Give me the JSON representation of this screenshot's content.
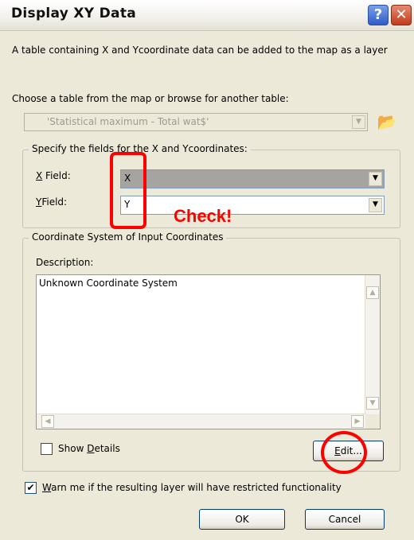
{
  "window": {
    "title": "Display XY Data",
    "help_glyph": "?",
    "close_glyph": "✕"
  },
  "intro_text": "A table containing X and Ycoordinate data can be added to the map as a layer",
  "table_section": {
    "label": "Choose a table from the map or browse for another table:",
    "table_value": "'Statistical maximum - Total wat$'",
    "arrow_glyph": "▼",
    "browse_icon_glyph": "📂"
  },
  "fields_group": {
    "legend": "Specify the fields for the X and Ycoordinates:",
    "x_label_accel": "X",
    "x_label_rest": " Field:",
    "x_value": "X",
    "y_label_accel": "Y",
    "y_label_rest": "Field:",
    "y_value": "Y",
    "arrow_glyph": "▼"
  },
  "coord_group": {
    "legend": "Coordinate System of Input Coordinates",
    "description_label": "Description:",
    "description_value": "Unknown Coordinate System",
    "show_details_pre": "Show ",
    "show_details_accel": "D",
    "show_details_post": "etails",
    "show_details_checked": false,
    "edit_accel": "E",
    "edit_rest": "dit..."
  },
  "scroll_glyphs": {
    "up": "▲",
    "down": "▼",
    "left": "◀",
    "right": "▶"
  },
  "warn": {
    "accel": "W",
    "rest": "arn me if the resulting layer will have restricted functionality",
    "checked": true,
    "check_glyph": "✔"
  },
  "buttons": {
    "ok": "OK",
    "cancel": "Cancel"
  },
  "annotation": {
    "check_text": "Check!",
    "color": "#ff0000"
  }
}
